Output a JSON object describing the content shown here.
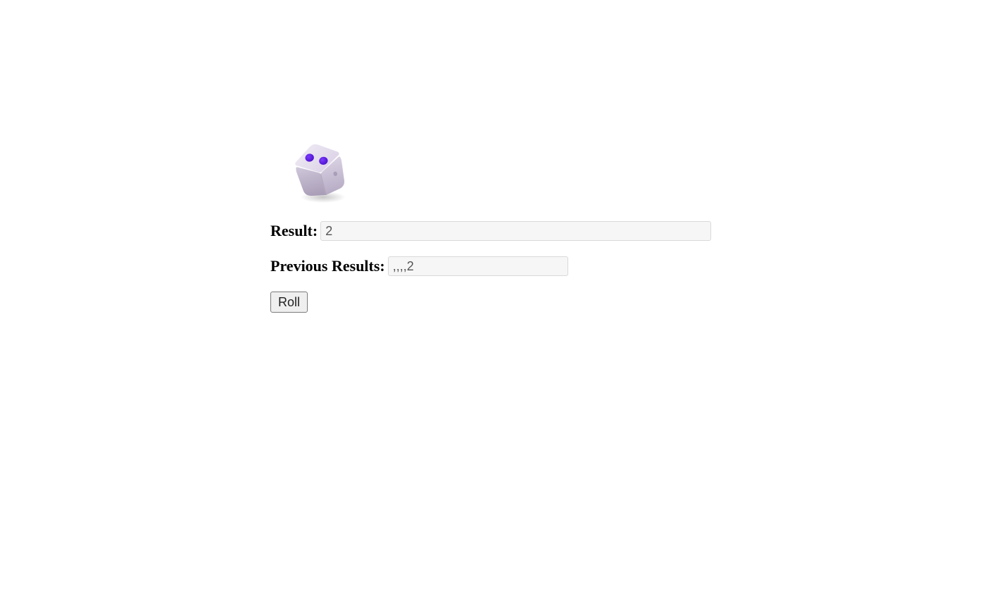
{
  "die": {
    "face_value": 2,
    "pip_color": "#5a18e0",
    "body_light": "#eae3f0",
    "body_mid": "#cfc7da",
    "body_dark": "#a79bb5",
    "rotation_deg": -14
  },
  "labels": {
    "result": "Result:",
    "previous": "Previous Results:"
  },
  "values": {
    "result": "2",
    "previous": ",,,,2"
  },
  "buttons": {
    "roll": "Roll"
  }
}
